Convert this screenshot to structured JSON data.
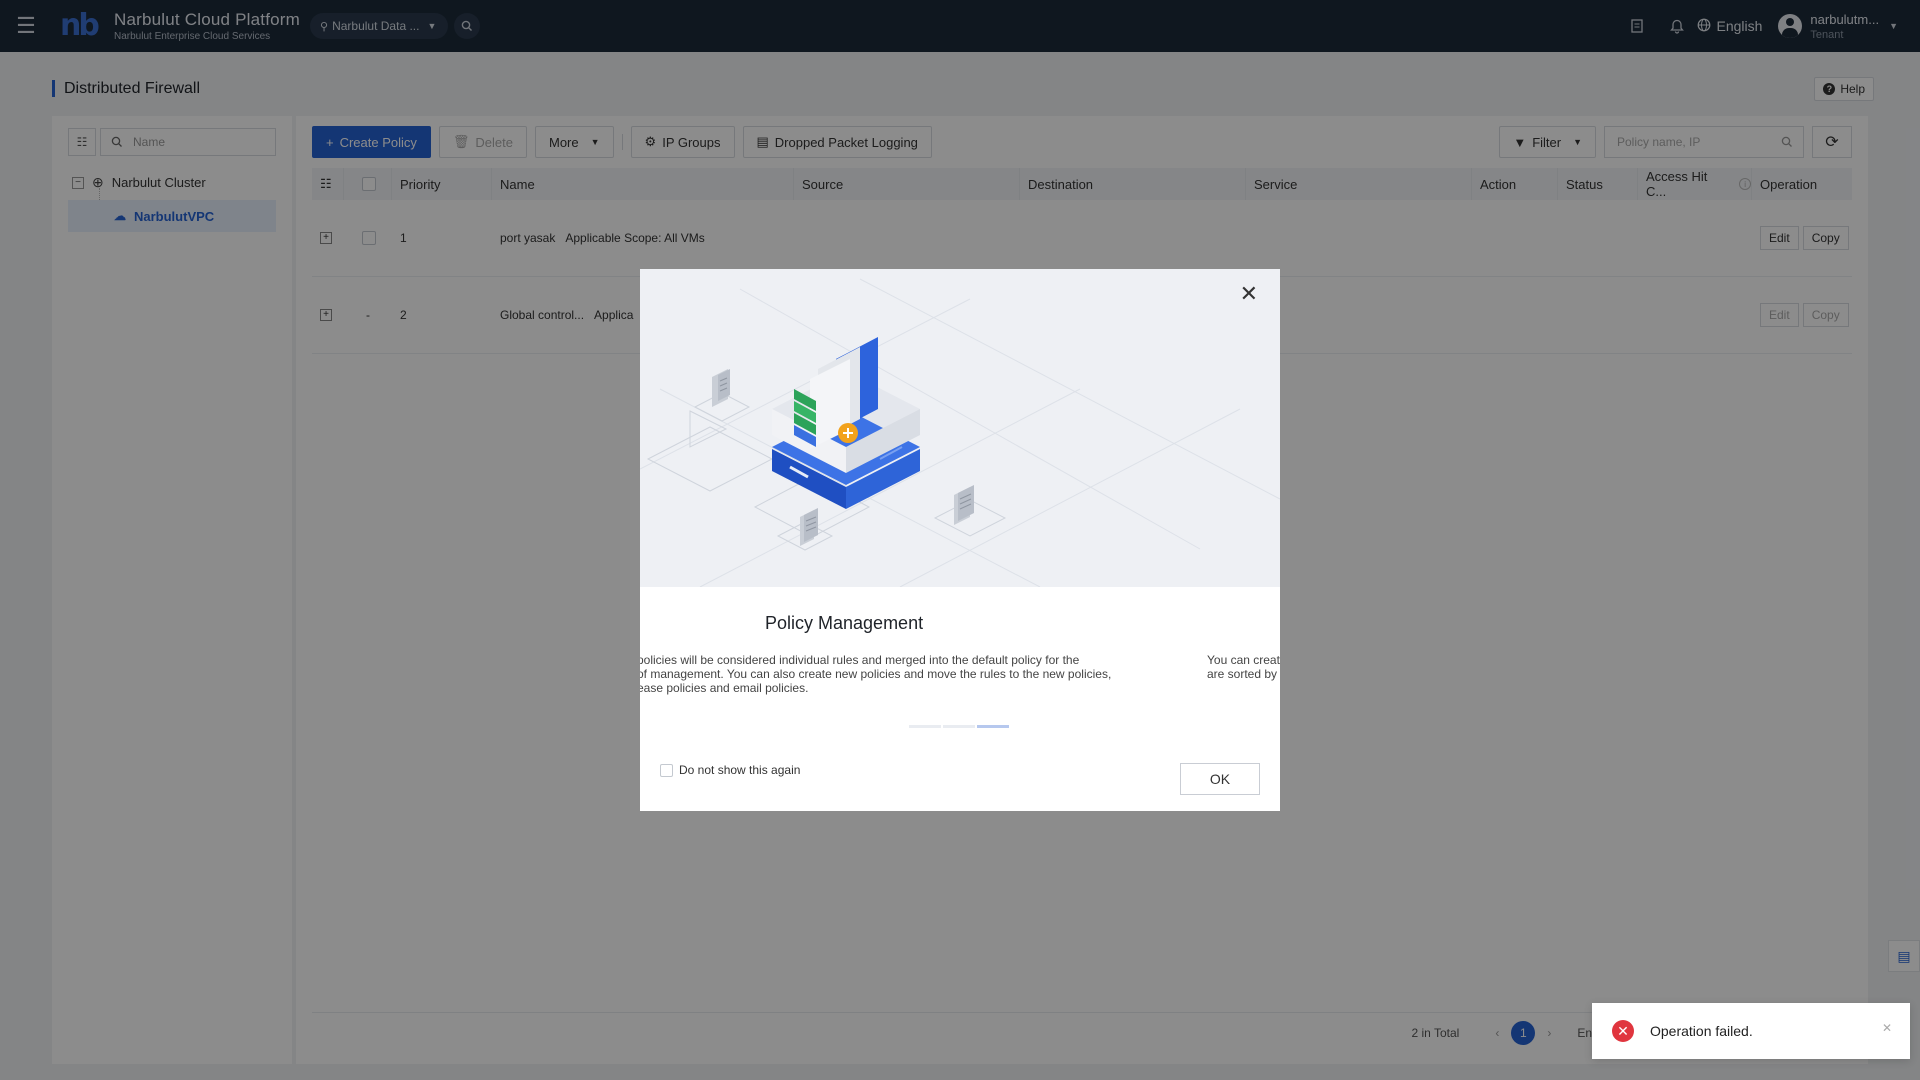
{
  "topbar": {
    "brand_name": "Narbulut Cloud Platform",
    "brand_sub": "Narbulut Enterprise Cloud Services",
    "logo_text": "nb",
    "region": "Narbulut Data ...",
    "language": "English",
    "user_name": "narbulutm...",
    "user_role": "Tenant",
    "icons": [
      "menu-icon",
      "search-icon",
      "document-icon",
      "bell-icon",
      "globe-icon"
    ]
  },
  "page": {
    "title": "Distributed Firewall",
    "help": "Help"
  },
  "tree": {
    "search_placeholder": "Name",
    "root": "Narbulut Cluster",
    "child": "NarbulutVPC"
  },
  "toolbar": {
    "create": "Create Policy",
    "delete": "Delete",
    "more": "More",
    "ip_groups": "IP Groups",
    "dropped_logging": "Dropped Packet Logging",
    "filter": "Filter",
    "search_placeholder": "Policy name, IP"
  },
  "table": {
    "columns": [
      "Priority",
      "Name",
      "Source",
      "Destination",
      "Service",
      "Action",
      "Status",
      "Access Hit C...",
      "Operation"
    ],
    "rows": [
      {
        "check": "",
        "priority": "1",
        "name": "port yasak",
        "scope": "Applicable Scope: All VMs",
        "edit": "Edit",
        "copy": "Copy"
      },
      {
        "check": "-",
        "priority": "2",
        "name": "Global control...",
        "scope": "Applica",
        "edit": "Edit",
        "copy": "Copy"
      }
    ]
  },
  "pager": {
    "total": "2 in Total",
    "page": "1",
    "trail": "En"
  },
  "modal": {
    "title": "Policy Management",
    "desc_line1": "policies will be considered individual rules and merged into the default policy for the",
    "desc_line2": "of management. You can also create new policies and move the rules to the new policies,",
    "desc_line3": "ease policies and email policies.",
    "desc2_line1": "You can creat",
    "desc2_line2": "are sorted by",
    "dont_show": "Do not show this again",
    "ok": "OK"
  },
  "toast": {
    "message": "Operation failed."
  },
  "colors": {
    "accent": "#2663d4",
    "topbar": "#1c2a3a",
    "error": "#e0353e"
  }
}
